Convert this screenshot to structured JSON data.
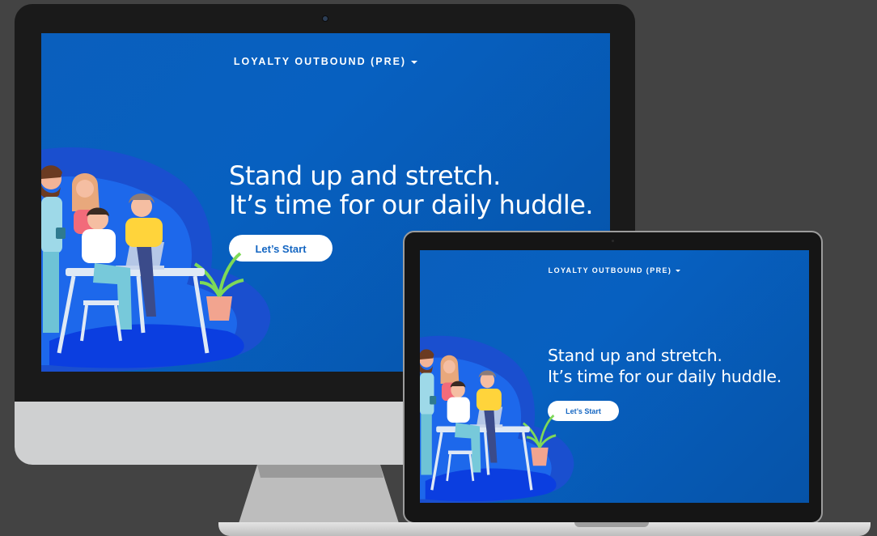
{
  "app": {
    "menu_title": "LOYALTY OUTBOUND (PRE)",
    "menu_icon": "chevron-down-icon",
    "headline_line1": "Stand up and stretch.",
    "headline_line2": "It’s time for our daily huddle.",
    "start_button_label": "Let’s Start"
  },
  "colors": {
    "background": "#434343",
    "screen_blue": "#0760c0",
    "button_text": "#1466c2",
    "text": "#ffffff"
  },
  "illustration": "team-at-desk-illustration"
}
